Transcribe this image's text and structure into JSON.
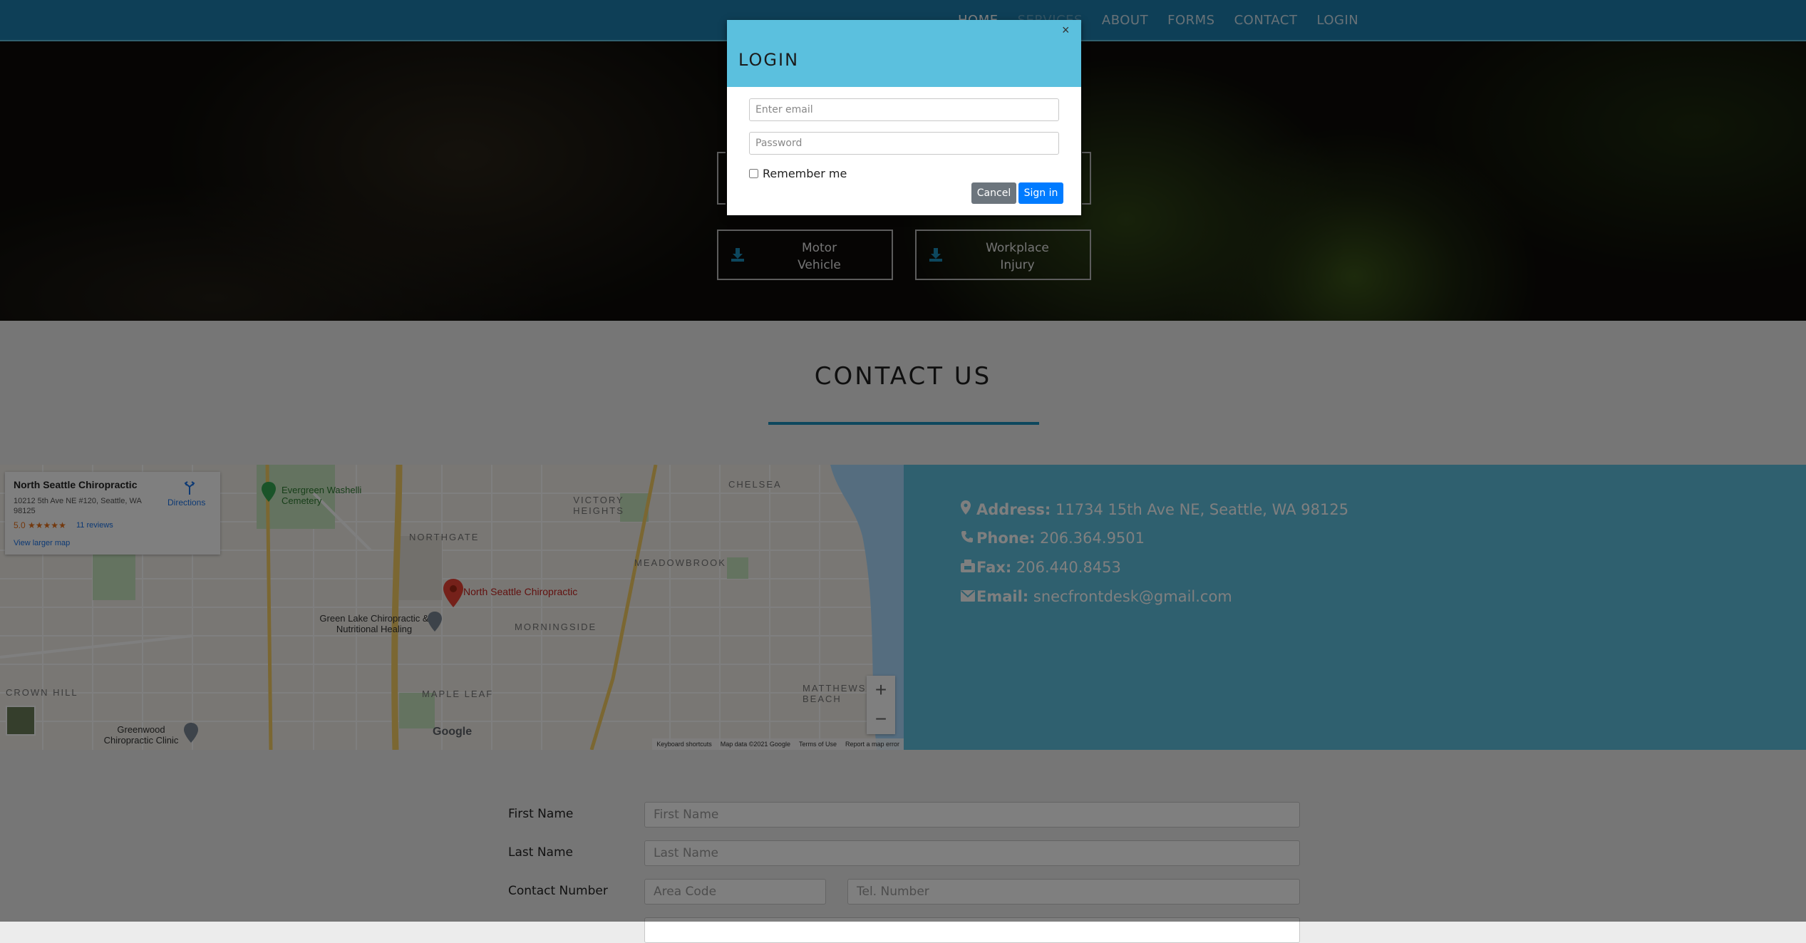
{
  "nav": {
    "items": [
      {
        "label": "HOME"
      },
      {
        "label": "SERVICES"
      },
      {
        "label": "ABOUT"
      },
      {
        "label": "FORMS"
      },
      {
        "label": "CONTACT"
      },
      {
        "label": "LOGIN"
      }
    ]
  },
  "hero": {
    "buttons": [
      {
        "label_line1": "Motor",
        "label_line2": "Vehicle",
        "icon": "download-icon"
      },
      {
        "label_line1": "Workplace",
        "label_line2": "Injury",
        "icon": "download-icon"
      }
    ]
  },
  "contact": {
    "title": "CONTACT US",
    "address_label": "Address:",
    "address": "11734 15th Ave NE, Seattle, WA 98125",
    "phone_label": "Phone:",
    "phone": "206.364.9501",
    "fax_label": "Fax:",
    "fax": "206.440.8453",
    "email_label": "Email:",
    "email": "snecfrontdesk@gmail.com",
    "accent_color": "#5fc0df"
  },
  "map": {
    "place_name": "North Seattle Chiropractic",
    "place_address": "10212 5th Ave NE #120, Seattle, WA 98125",
    "rating": "5.0",
    "stars": "★★★★★",
    "reviews": "11 reviews",
    "view_larger": "View larger map",
    "directions": "Directions",
    "pin_label": "North Seattle Chiropractic",
    "labels": {
      "chelsea": "CHELSEA",
      "victory_heights": "VICTORY HEIGHTS",
      "northgate": "NORTHGATE",
      "meadowbrook": "MEADOWBROOK",
      "morningside": "MORNINGSIDE",
      "maple_leaf": "MAPLE LEAF",
      "crown_hill": "CROWN HILL",
      "matthews_beach": "MATTHEWS BEACH",
      "evergreen": "Evergreen Washelli Cemetery",
      "green_lake": "Green Lake Chiropractic & Nutritional Healing",
      "greenwood": "Greenwood Chiropractic Clinic",
      "google": "Google"
    },
    "footer": [
      "Keyboard shortcuts",
      "Map data ©2021 Google",
      "Terms of Use",
      "Report a map error"
    ],
    "zoom_in": "+",
    "zoom_out": "−"
  },
  "form": {
    "first_name_label": "First Name",
    "first_name_placeholder": "First Name",
    "last_name_label": "Last Name",
    "last_name_placeholder": "Last Name",
    "contact_label": "Contact Number",
    "area_code_placeholder": "Area Code",
    "tel_placeholder": "Tel. Number"
  },
  "modal": {
    "title": "LOGIN",
    "close": "×",
    "email_placeholder": "Enter email",
    "password_placeholder": "Password",
    "remember": "Remember me",
    "cancel": "Cancel",
    "sign_in": "Sign in",
    "header_color": "#5bc0de"
  }
}
